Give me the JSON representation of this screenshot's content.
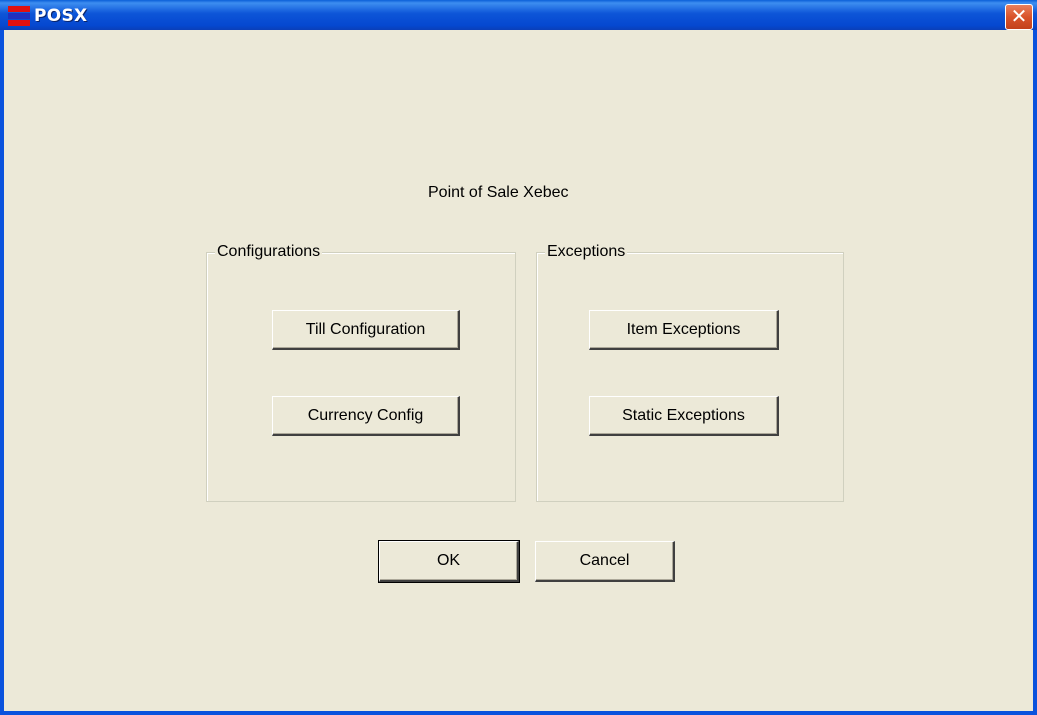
{
  "window": {
    "title": "POSX",
    "close_symbol": "✕"
  },
  "main": {
    "caption": "Point of Sale Xebec"
  },
  "configurations": {
    "label": "Configurations",
    "buttons": [
      "Till Configuration",
      "Currency Config"
    ]
  },
  "exceptions": {
    "label": "Exceptions",
    "buttons": [
      "Item Exceptions",
      "Static Exceptions"
    ]
  },
  "footer": {
    "ok_label": "OK",
    "cancel_label": "Cancel"
  },
  "colors": {
    "titlebar": "#0A52DD",
    "dialog_background": "#ECE9D8",
    "close_button": "#D9532B"
  }
}
